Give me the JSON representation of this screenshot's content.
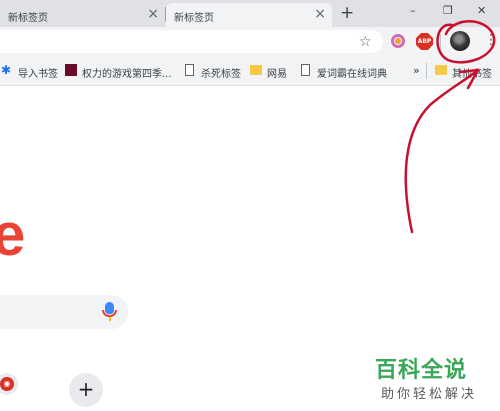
{
  "tabs": [
    {
      "title": "新标签页",
      "close": "×"
    },
    {
      "title": "新标签页",
      "close": "×"
    }
  ],
  "new_tab": "+",
  "window_controls": {
    "minimize": "–",
    "restore": "❐",
    "close": "✕"
  },
  "toolbar": {
    "star": "☆",
    "extension_abp": "ABP",
    "menu": "⋮"
  },
  "bookmarks": [
    {
      "label": "导入书签",
      "icon": "gear-icon"
    },
    {
      "label": "权力的游戏第四季...",
      "icon": "got-icon"
    },
    {
      "label": "杀死标签",
      "icon": "page-icon"
    },
    {
      "label": "网易",
      "icon": "folder-icon"
    },
    {
      "label": "爱词霸在线词典",
      "icon": "page-icon"
    },
    {
      "label": "其他书签",
      "icon": "folder-icon"
    }
  ],
  "bookmarks_more": "»",
  "page": {
    "logo_letter": "e",
    "add_shortcut": "+"
  },
  "watermark": {
    "title": "百科全说",
    "subtitle": "助你轻松解决"
  },
  "colors": {
    "annotation": "#c8102e",
    "watermark_green": "#3aa657"
  }
}
